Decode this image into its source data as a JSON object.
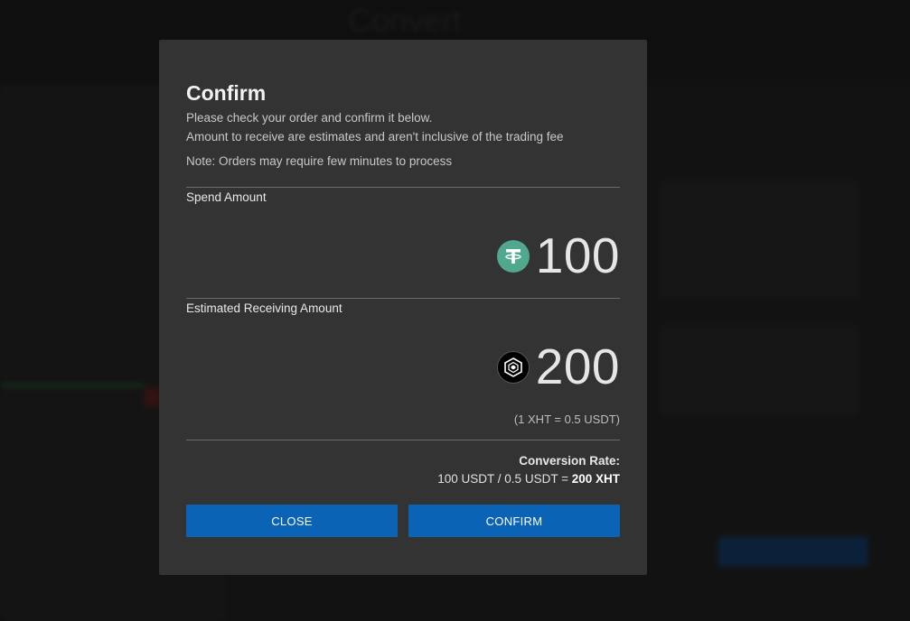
{
  "modal": {
    "title": "Confirm",
    "line1": "Please check your order and confirm it below.",
    "line2": "Amount to receive are estimates and aren't inclusive of the trading fee",
    "note": "Note: Orders may require few minutes to process",
    "spend": {
      "label": "Spend Amount",
      "amount": "100",
      "icon": "tether-icon",
      "icon_color": "#50a88f"
    },
    "receive": {
      "label": "Estimated Receiving Amount",
      "amount": "200",
      "icon": "xht-coin-icon",
      "rate_note": "(1 XHT = 0.5 USDT)"
    },
    "conversion": {
      "label": "Conversion Rate:",
      "formula_prefix": "100 USDT / 0.5 USDT = ",
      "formula_result": "200 XHT"
    },
    "buttons": {
      "close": "CLOSE",
      "confirm": "CONFIRM"
    }
  },
  "background": {
    "page_title": "Convert"
  },
  "colors": {
    "modal_bg": "#333333",
    "button_bg": "#0b63b6",
    "text_primary": "#e6e6e6"
  }
}
